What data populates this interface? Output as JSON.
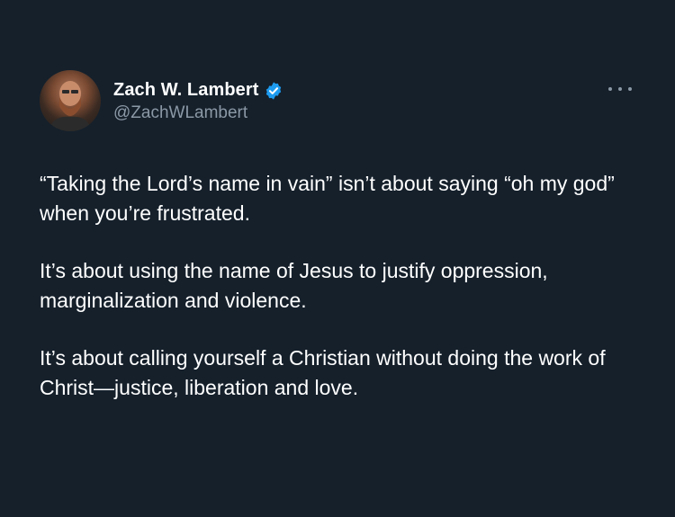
{
  "author": {
    "display_name": "Zach W. Lambert",
    "handle": "@ZachWLambert",
    "avatar_icon": "person-avatar",
    "verified_icon": "verified-badge-icon",
    "verified_color": "#1d9bf0"
  },
  "menu": {
    "more_icon": "more-horizontal-icon"
  },
  "tweet": {
    "paragraphs": [
      "“Taking the Lord’s name in vain” isn’t about saying “oh my god” when you’re frustrated.",
      "It’s about using the name of Jesus to justify oppression, marginalization and violence.",
      "It’s about calling yourself a Christian without doing the work of Christ—justice, liberation and love."
    ]
  },
  "colors": {
    "background": "#15202b",
    "text_primary": "#ffffff",
    "text_secondary": "#8b98a5"
  }
}
